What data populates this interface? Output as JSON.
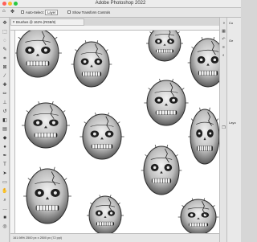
{
  "window": {
    "title": "Adobe Photoshop 2022",
    "close_color": "#ff5f57",
    "minimize_color": "#febc2e",
    "zoom_color": "#28c840"
  },
  "options_bar": {
    "auto_select_label": "Auto-Select:",
    "auto_select_target": "Layer",
    "transform_controls_label": "Show Transform Controls"
  },
  "tools": [
    {
      "name": "move-tool-icon",
      "glyph": "✥"
    },
    {
      "name": "marquee-tool-icon",
      "glyph": "⬚"
    },
    {
      "name": "lasso-tool-icon",
      "glyph": "◌"
    },
    {
      "name": "quick-select-tool-icon",
      "glyph": "✎"
    },
    {
      "name": "crop-tool-icon",
      "glyph": "⌗"
    },
    {
      "name": "frame-tool-icon",
      "glyph": "⊠"
    },
    {
      "name": "eyedropper-tool-icon",
      "glyph": "⁄"
    },
    {
      "name": "healing-brush-tool-icon",
      "glyph": "✚"
    },
    {
      "name": "brush-tool-icon",
      "glyph": "✏"
    },
    {
      "name": "clone-stamp-tool-icon",
      "glyph": "⊥"
    },
    {
      "name": "history-brush-tool-icon",
      "glyph": "↺"
    },
    {
      "name": "eraser-tool-icon",
      "glyph": "◧"
    },
    {
      "name": "gradient-tool-icon",
      "glyph": "▤"
    },
    {
      "name": "blur-tool-icon",
      "glyph": "◆"
    },
    {
      "name": "dodge-tool-icon",
      "glyph": "●"
    },
    {
      "name": "pen-tool-icon",
      "glyph": "✒"
    },
    {
      "name": "type-tool-icon",
      "glyph": "T"
    },
    {
      "name": "path-select-tool-icon",
      "glyph": "➤"
    },
    {
      "name": "rectangle-tool-icon",
      "glyph": "▭"
    },
    {
      "name": "hand-tool-icon",
      "glyph": "✋"
    },
    {
      "name": "zoom-tool-icon",
      "glyph": "⌕"
    },
    {
      "name": "more-tools-icon",
      "glyph": "…"
    },
    {
      "name": "foreground-color-icon",
      "glyph": "■"
    },
    {
      "name": "quick-mask-icon",
      "glyph": "◎"
    }
  ],
  "document": {
    "tab_label": "Brushes @ 162% (RGB/8)",
    "status": "161.98%   2500 px x 2500 px (72 ppi)"
  },
  "panels": {
    "icons": [
      {
        "name": "color-panel-icon",
        "glyph": "◑"
      },
      {
        "name": "swatches-panel-icon",
        "glyph": "▦"
      },
      {
        "name": "history-panel-icon",
        "glyph": "↶"
      },
      {
        "name": "properties-panel-icon",
        "glyph": "≡"
      },
      {
        "name": "adjustments-panel-icon",
        "glyph": "◐"
      },
      {
        "name": "layers-panel-icon",
        "glyph": "❐"
      }
    ],
    "side_labels": [
      "Co",
      "Ge",
      "Layo"
    ]
  }
}
